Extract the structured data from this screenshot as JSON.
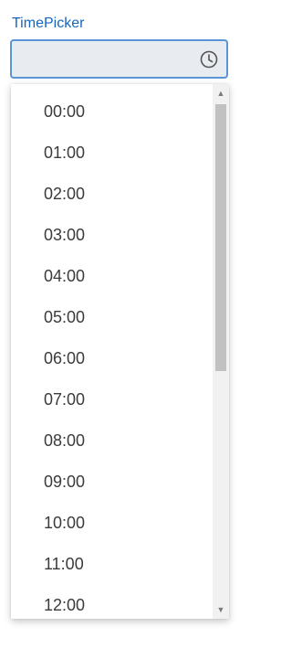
{
  "timepicker": {
    "label": "TimePicker",
    "value": "",
    "icon": "clock-icon"
  },
  "dropdown": {
    "items": [
      {
        "label": "00:00"
      },
      {
        "label": "01:00"
      },
      {
        "label": "02:00"
      },
      {
        "label": "03:00"
      },
      {
        "label": "04:00"
      },
      {
        "label": "05:00"
      },
      {
        "label": "06:00"
      },
      {
        "label": "07:00"
      },
      {
        "label": "08:00"
      },
      {
        "label": "09:00"
      },
      {
        "label": "10:00"
      },
      {
        "label": "11:00"
      },
      {
        "label": "12:00"
      }
    ]
  },
  "colors": {
    "accent": "#1565c0",
    "input_border": "#5a95d6",
    "input_bg": "#e8ebf0"
  }
}
